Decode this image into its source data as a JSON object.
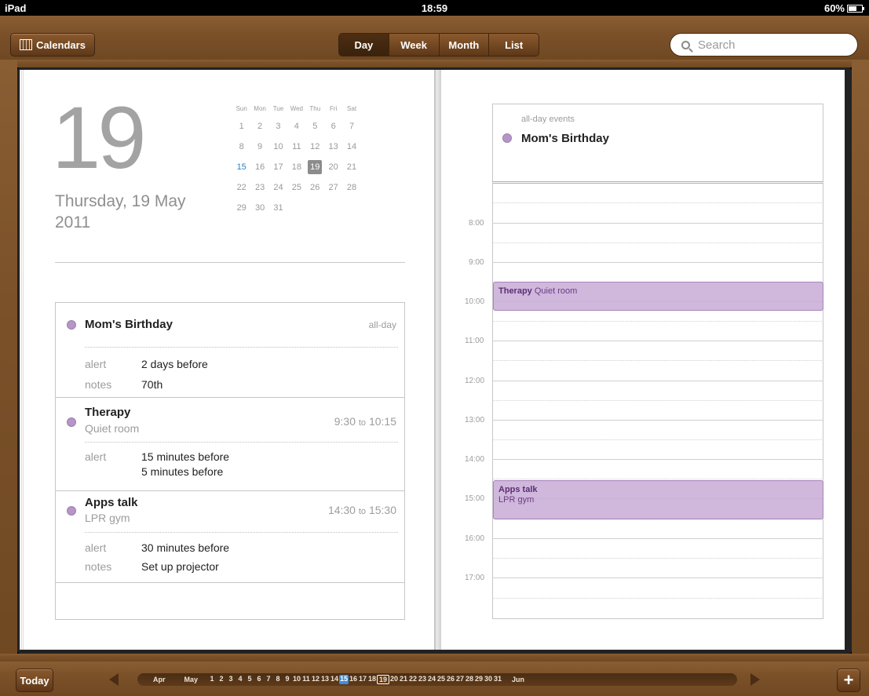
{
  "status": {
    "device": "iPad",
    "time": "18:59",
    "battery": "60%",
    "battery_level": 0.6
  },
  "toolbar": {
    "calendars_label": "Calendars",
    "view_tabs": [
      "Day",
      "Week",
      "Month",
      "List"
    ],
    "selected_view": "Day",
    "search_placeholder": "Search"
  },
  "left_page": {
    "day_number": "19",
    "date_line": "Thursday, 19 May 2011",
    "mini_calendar": {
      "weekdays": [
        "Sun",
        "Mon",
        "Tue",
        "Wed",
        "Thu",
        "Fri",
        "Sat"
      ],
      "weeks": [
        [
          "1",
          "2",
          "3",
          "4",
          "5",
          "6",
          "7"
        ],
        [
          "8",
          "9",
          "10",
          "11",
          "12",
          "13",
          "14"
        ],
        [
          "15",
          "16",
          "17",
          "18",
          "19",
          "20",
          "21"
        ],
        [
          "22",
          "23",
          "24",
          "25",
          "26",
          "27",
          "28"
        ],
        [
          "29",
          "30",
          "31",
          "",
          "",
          "",
          ""
        ]
      ],
      "today": "15",
      "selected": "19"
    },
    "events": [
      {
        "title": "Mom's Birthday",
        "time": "all-day",
        "alert_label": "alert",
        "alert": "2 days before",
        "notes_label": "notes",
        "notes": "70th"
      },
      {
        "title": "Therapy",
        "location": "Quiet room",
        "start": "9:30",
        "to": "to",
        "end": "10:15",
        "alert_label": "alert",
        "alert1": "15 minutes before",
        "alert2": "5 minutes before"
      },
      {
        "title": "Apps talk",
        "location": "LPR gym",
        "start": "14:30",
        "to": "to",
        "end": "15:30",
        "alert_label": "alert",
        "alert": "30 minutes before",
        "notes_label": "notes",
        "notes": "Set up projector"
      }
    ]
  },
  "right_page": {
    "all_day_label": "all-day events",
    "all_day_event": "Mom's Birthday",
    "hours": [
      "8:00",
      "9:00",
      "10:00",
      "11:00",
      "12:00",
      "13:00",
      "14:00",
      "15:00",
      "16:00",
      "17:00"
    ],
    "blocks": [
      {
        "title": "Therapy",
        "location": "Quiet room"
      },
      {
        "title": "Apps talk",
        "location": "LPR gym"
      }
    ]
  },
  "bottom": {
    "today_label": "Today",
    "add_label": "+",
    "timeline_start_month": "Apr",
    "timeline_month": "May",
    "timeline_days": [
      "1",
      "2",
      "3",
      "4",
      "5",
      "6",
      "7",
      "8",
      "9",
      "10",
      "11",
      "12",
      "13",
      "14",
      "15",
      "16",
      "17",
      "18",
      "19",
      "20",
      "21",
      "22",
      "23",
      "24",
      "25",
      "26",
      "27",
      "28",
      "29",
      "30",
      "31"
    ],
    "timeline_end_month": "Jun",
    "current_day": "15",
    "selected_day": "19"
  },
  "colors": {
    "event": "#b596c6",
    "today_blue": "#2b7fc7",
    "leather": "#7b5129"
  }
}
